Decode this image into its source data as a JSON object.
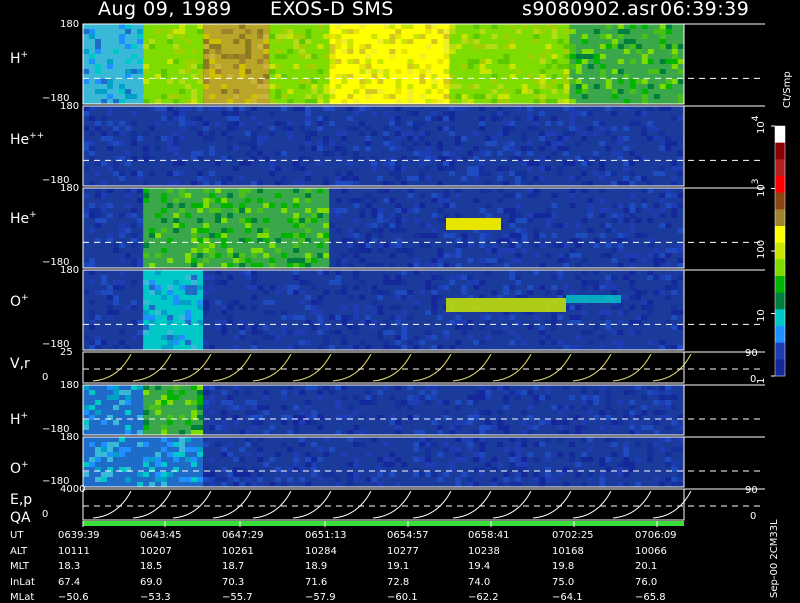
{
  "title": {
    "date": "Aug 09, 1989",
    "instrument": "EXOS-D SMS",
    "file": "s9080902.asr",
    "time": "06:39:39"
  },
  "panels": [
    {
      "label": "H",
      "sup": "+",
      "top": "180",
      "bottom": "−180",
      "kind": "spec"
    },
    {
      "label": "He",
      "sup": "++",
      "top": "180",
      "bottom": "−180",
      "kind": "spec"
    },
    {
      "label": "He",
      "sup": "+",
      "top": "180",
      "bottom": "−180",
      "kind": "spec"
    },
    {
      "label": "O",
      "sup": "+",
      "top": "180",
      "bottom": "−180",
      "kind": "spec"
    },
    {
      "label": "V,r",
      "sup": "",
      "top": "25",
      "bottom": "0",
      "kind": "line",
      "right_top": "90",
      "right_bottom": "0"
    },
    {
      "label": "H",
      "sup": "+",
      "top": "180",
      "bottom": "−180",
      "kind": "spec2"
    },
    {
      "label": "O",
      "sup": "+",
      "top": "180",
      "bottom": "−180",
      "kind": "spec2"
    },
    {
      "label": "E,p",
      "sup": "",
      "top": "4000",
      "bottom": "0",
      "kind": "line",
      "right_top": "90",
      "right_bottom": "0"
    }
  ],
  "qa_label": "QA",
  "colorbar": {
    "unit": "Ct/Smp",
    "ticks": [
      {
        "label": "10",
        "sup": "4",
        "value": 10000
      },
      {
        "label": "10",
        "sup": "3",
        "value": 1000
      },
      {
        "label": "100",
        "sup": "",
        "value": 100
      },
      {
        "label": "10",
        "sup": "",
        "value": 10
      },
      {
        "label": "1",
        "sup": "",
        "value": 1
      }
    ],
    "colors": [
      "#ffffff",
      "#8b0000",
      "#b22222",
      "#ff0000",
      "#8b4513",
      "#a0822d",
      "#ffff00",
      "#c8e600",
      "#7fdc00",
      "#00b400",
      "#007f3c",
      "#00c8c8",
      "#1e90ff",
      "#1e3cb4",
      "#14289c"
    ]
  },
  "footer": {
    "rows": [
      {
        "label": "UT",
        "values": [
          "0639:39",
          "0643:45",
          "0647:29",
          "0651:13",
          "0654:57",
          "0658:41",
          "0702:25",
          "0706:09"
        ]
      },
      {
        "label": "ALT",
        "values": [
          "10111",
          "10207",
          "10261",
          "10284",
          "10277",
          "10238",
          "10168",
          "10066"
        ]
      },
      {
        "label": "MLT",
        "values": [
          "18.3",
          "18.5",
          "18.7",
          "18.9",
          "19.1",
          "19.4",
          "19.8",
          "20.1"
        ]
      },
      {
        "label": "InLat",
        "values": [
          "67.4",
          "69.0",
          "70.3",
          "71.6",
          "72.8",
          "74.0",
          "75.0",
          "76.0"
        ]
      },
      {
        "label": "MLat",
        "values": [
          "−50.6",
          "−53.3",
          "−55.7",
          "−57.9",
          "−60.1",
          "−62.2",
          "−64.1",
          "−65.8"
        ]
      }
    ],
    "stamp": "Sep-00 2CM33L"
  },
  "chart_data": {
    "type": "heatmap",
    "x_axis": {
      "label": "UT",
      "ticks": [
        "0639:39",
        "0643:45",
        "0647:29",
        "0651:13",
        "0654:57",
        "0658:41",
        "0702:25",
        "0706:09"
      ]
    },
    "y_axis": {
      "panels": [
        "H+",
        "He++",
        "He+",
        "O+",
        "V,r",
        "H+",
        "O+",
        "E,p"
      ],
      "range": [
        -180,
        180
      ]
    },
    "color_scale": {
      "unit": "Ct/Smp",
      "scale": "log",
      "range": [
        1,
        10000
      ]
    },
    "segments": {
      "H+": [
        {
          "from": 0,
          "to": 0.1,
          "level": "#3ab8d8"
        },
        {
          "from": 0.1,
          "to": 0.2,
          "level": "#7fdc00"
        },
        {
          "from": 0.2,
          "to": 0.31,
          "level": "#b9a628"
        },
        {
          "from": 0.31,
          "to": 0.41,
          "level": "#7fdc00"
        },
        {
          "from": 0.41,
          "to": 0.61,
          "level": "#ffff00"
        },
        {
          "from": 0.61,
          "to": 0.81,
          "level": "#7fdc00"
        },
        {
          "from": 0.81,
          "to": 1,
          "level": "#3aa84a"
        }
      ],
      "He++": [
        {
          "from": 0,
          "to": 1,
          "level": "#1a3a9c"
        }
      ],
      "He+": [
        {
          "from": 0,
          "to": 0.1,
          "level": "#1a3a9c"
        },
        {
          "from": 0.1,
          "to": 0.41,
          "level": "#3aa84a"
        },
        {
          "from": 0.41,
          "to": 1,
          "level": "#1a3a9c"
        }
      ],
      "O+": [
        {
          "from": 0,
          "to": 0.1,
          "level": "#1a3a9c"
        },
        {
          "from": 0.1,
          "to": 0.2,
          "level": "#00c8c8"
        },
        {
          "from": 0.2,
          "to": 1,
          "level": "#1a3a9c"
        }
      ],
      "H+ (2)": [
        {
          "from": 0,
          "to": 0.1,
          "level": "#1e6cc8"
        },
        {
          "from": 0.1,
          "to": 0.2,
          "level": "#3aa84a"
        },
        {
          "from": 0.2,
          "to": 1,
          "level": "#1a3a9c"
        }
      ],
      "O+ (2)": [
        {
          "from": 0,
          "to": 0.2,
          "level": "#1e6cc8"
        },
        {
          "from": 0.2,
          "to": 1,
          "level": "#1a3a9c"
        }
      ]
    }
  }
}
